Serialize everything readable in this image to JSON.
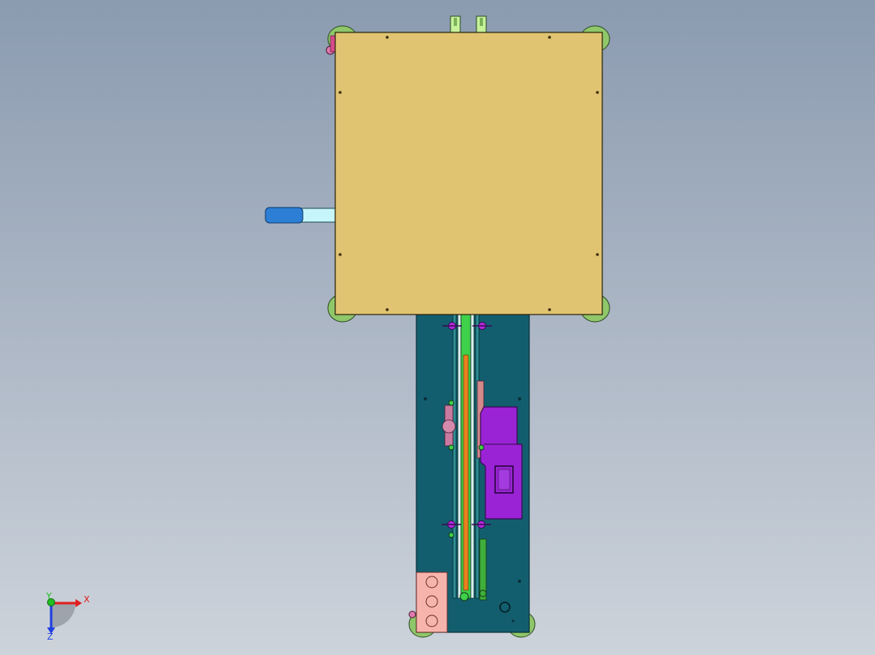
{
  "viewport": {
    "background_top": "#8b9bb0",
    "background_bottom": "#cdd3db"
  },
  "model": {
    "top_plate_color": "#e0c472",
    "base_plate_color": "#125e6e",
    "slide_block_color": "#9b23d6",
    "handle_grip_color": "#2c7fd4",
    "handle_shaft_color": "#c6f6fb",
    "pad_color": "#8fc76a",
    "rail_orange": "#e8811e",
    "rail_green": "#3fd14a",
    "bracket_color": "#f7b4ad"
  },
  "triad": {
    "x_label": "X",
    "y_label": "Y",
    "z_label": "Z",
    "x_color": "#e02020",
    "y_color": "#20c020",
    "z_color": "#2040e0"
  }
}
